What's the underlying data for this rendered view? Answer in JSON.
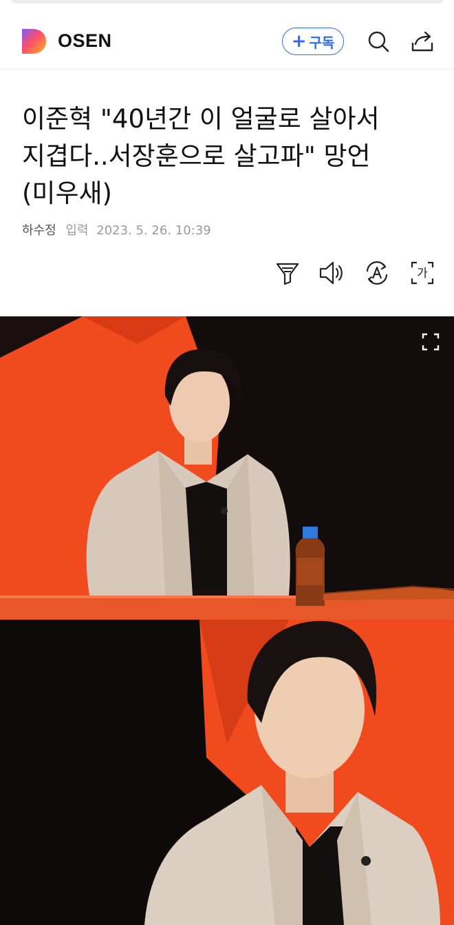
{
  "header": {
    "brand": "OSEN",
    "subscribe_label": "구독",
    "subscribe_plus": "+"
  },
  "article": {
    "title": "이준혁 \"40년간 이 얼굴로 살아서 지겹다..서장훈으로 살고파\" 망언(미우새)",
    "author": "하수정",
    "input_label": "입력",
    "date": "2023. 5. 26. 10:39"
  },
  "tools": {
    "font_icon_text": "가"
  },
  "colors": {
    "accent": "#2d6bf2",
    "stage_orange": "#f04a1e",
    "backdrop_black": "#120c0c",
    "jacket_beige": "#d8c9ba"
  },
  "icons": [
    "brand-logo-icon",
    "search-icon",
    "share-icon",
    "summary-filter-icon",
    "speaker-icon",
    "translate-icon",
    "font-size-icon",
    "expand-icon"
  ]
}
